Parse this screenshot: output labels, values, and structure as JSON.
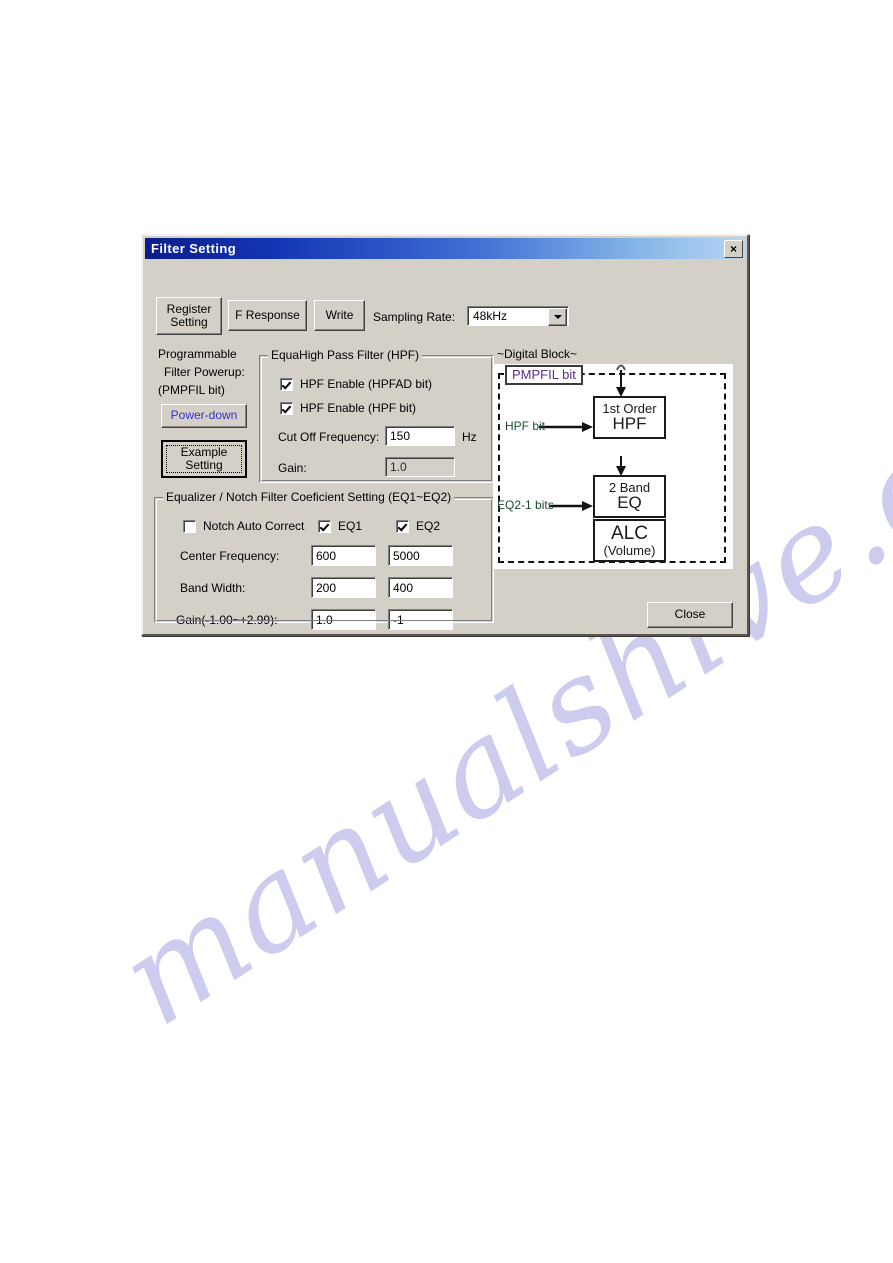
{
  "page": {
    "background": "#ffffff",
    "watermark": "manualshive.com"
  },
  "dialog": {
    "title": "Filter Setting",
    "close_icon": "×",
    "titlebar_color_start": "#0a1d8c",
    "titlebar_color_end": "#b7d6f2",
    "face_color": "#d4d0c8"
  },
  "toolbar": {
    "register_setting_label": "Register\nSetting",
    "f_response_label": "F Response",
    "write_label": "Write",
    "sampling_rate_label": "Sampling Rate:",
    "sampling_rate_value": "48kHz",
    "sampling_rate_options": [
      "48kHz"
    ]
  },
  "powerup": {
    "caption_line1": "Programmable",
    "caption_line2": "Filter Powerup:",
    "caption_line3": "(PMPFIL bit)",
    "power_down_label": "Power-down",
    "power_down_color": "#3333cc",
    "example_setting_label": "Example\nSetting"
  },
  "hpf_group": {
    "title": "EquaHigh Pass Filter (HPF)",
    "checkboxes": [
      {
        "label": "HPF Enable (HPFAD bit)",
        "checked": true
      },
      {
        "label": "HPF Enable (HPF bit)",
        "checked": true
      }
    ],
    "cutoff_label": "Cut Off Frequency:",
    "cutoff_value": "150",
    "cutoff_unit": "Hz",
    "gain_label": "Gain:",
    "gain_value": "1.0",
    "gain_disabled": true
  },
  "eq_group": {
    "title": "Equalizer / Notch Filter Coeficient Setting (EQ1~EQ2)",
    "notch_auto_correct_label": "Notch Auto Correct",
    "notch_auto_correct_checked": false,
    "eq1_label": "EQ1",
    "eq1_checked": true,
    "eq2_label": "EQ2",
    "eq2_checked": true,
    "rows": [
      {
        "label": "Center Frequency:",
        "eq1": "600",
        "eq2": "5000"
      },
      {
        "label": "Band Width:",
        "eq1": "200",
        "eq2": "400"
      },
      {
        "label": "Gain(-1.00~+2.99):",
        "eq1": "1.0",
        "eq2": "-1"
      }
    ]
  },
  "digital_block": {
    "caption": "~Digital Block~",
    "pmpfil_label": "PMPFIL bit",
    "hpf_bit_label": "HPF bit",
    "eq_bits_label": "EQ2-1 bits",
    "blocks": [
      {
        "line1": "1st Order",
        "line2": "HPF"
      },
      {
        "line1": "2 Band",
        "line2": "EQ"
      },
      {
        "line1": "ALC",
        "line2": "(Volume)"
      }
    ]
  },
  "footer": {
    "close_label": "Close"
  }
}
